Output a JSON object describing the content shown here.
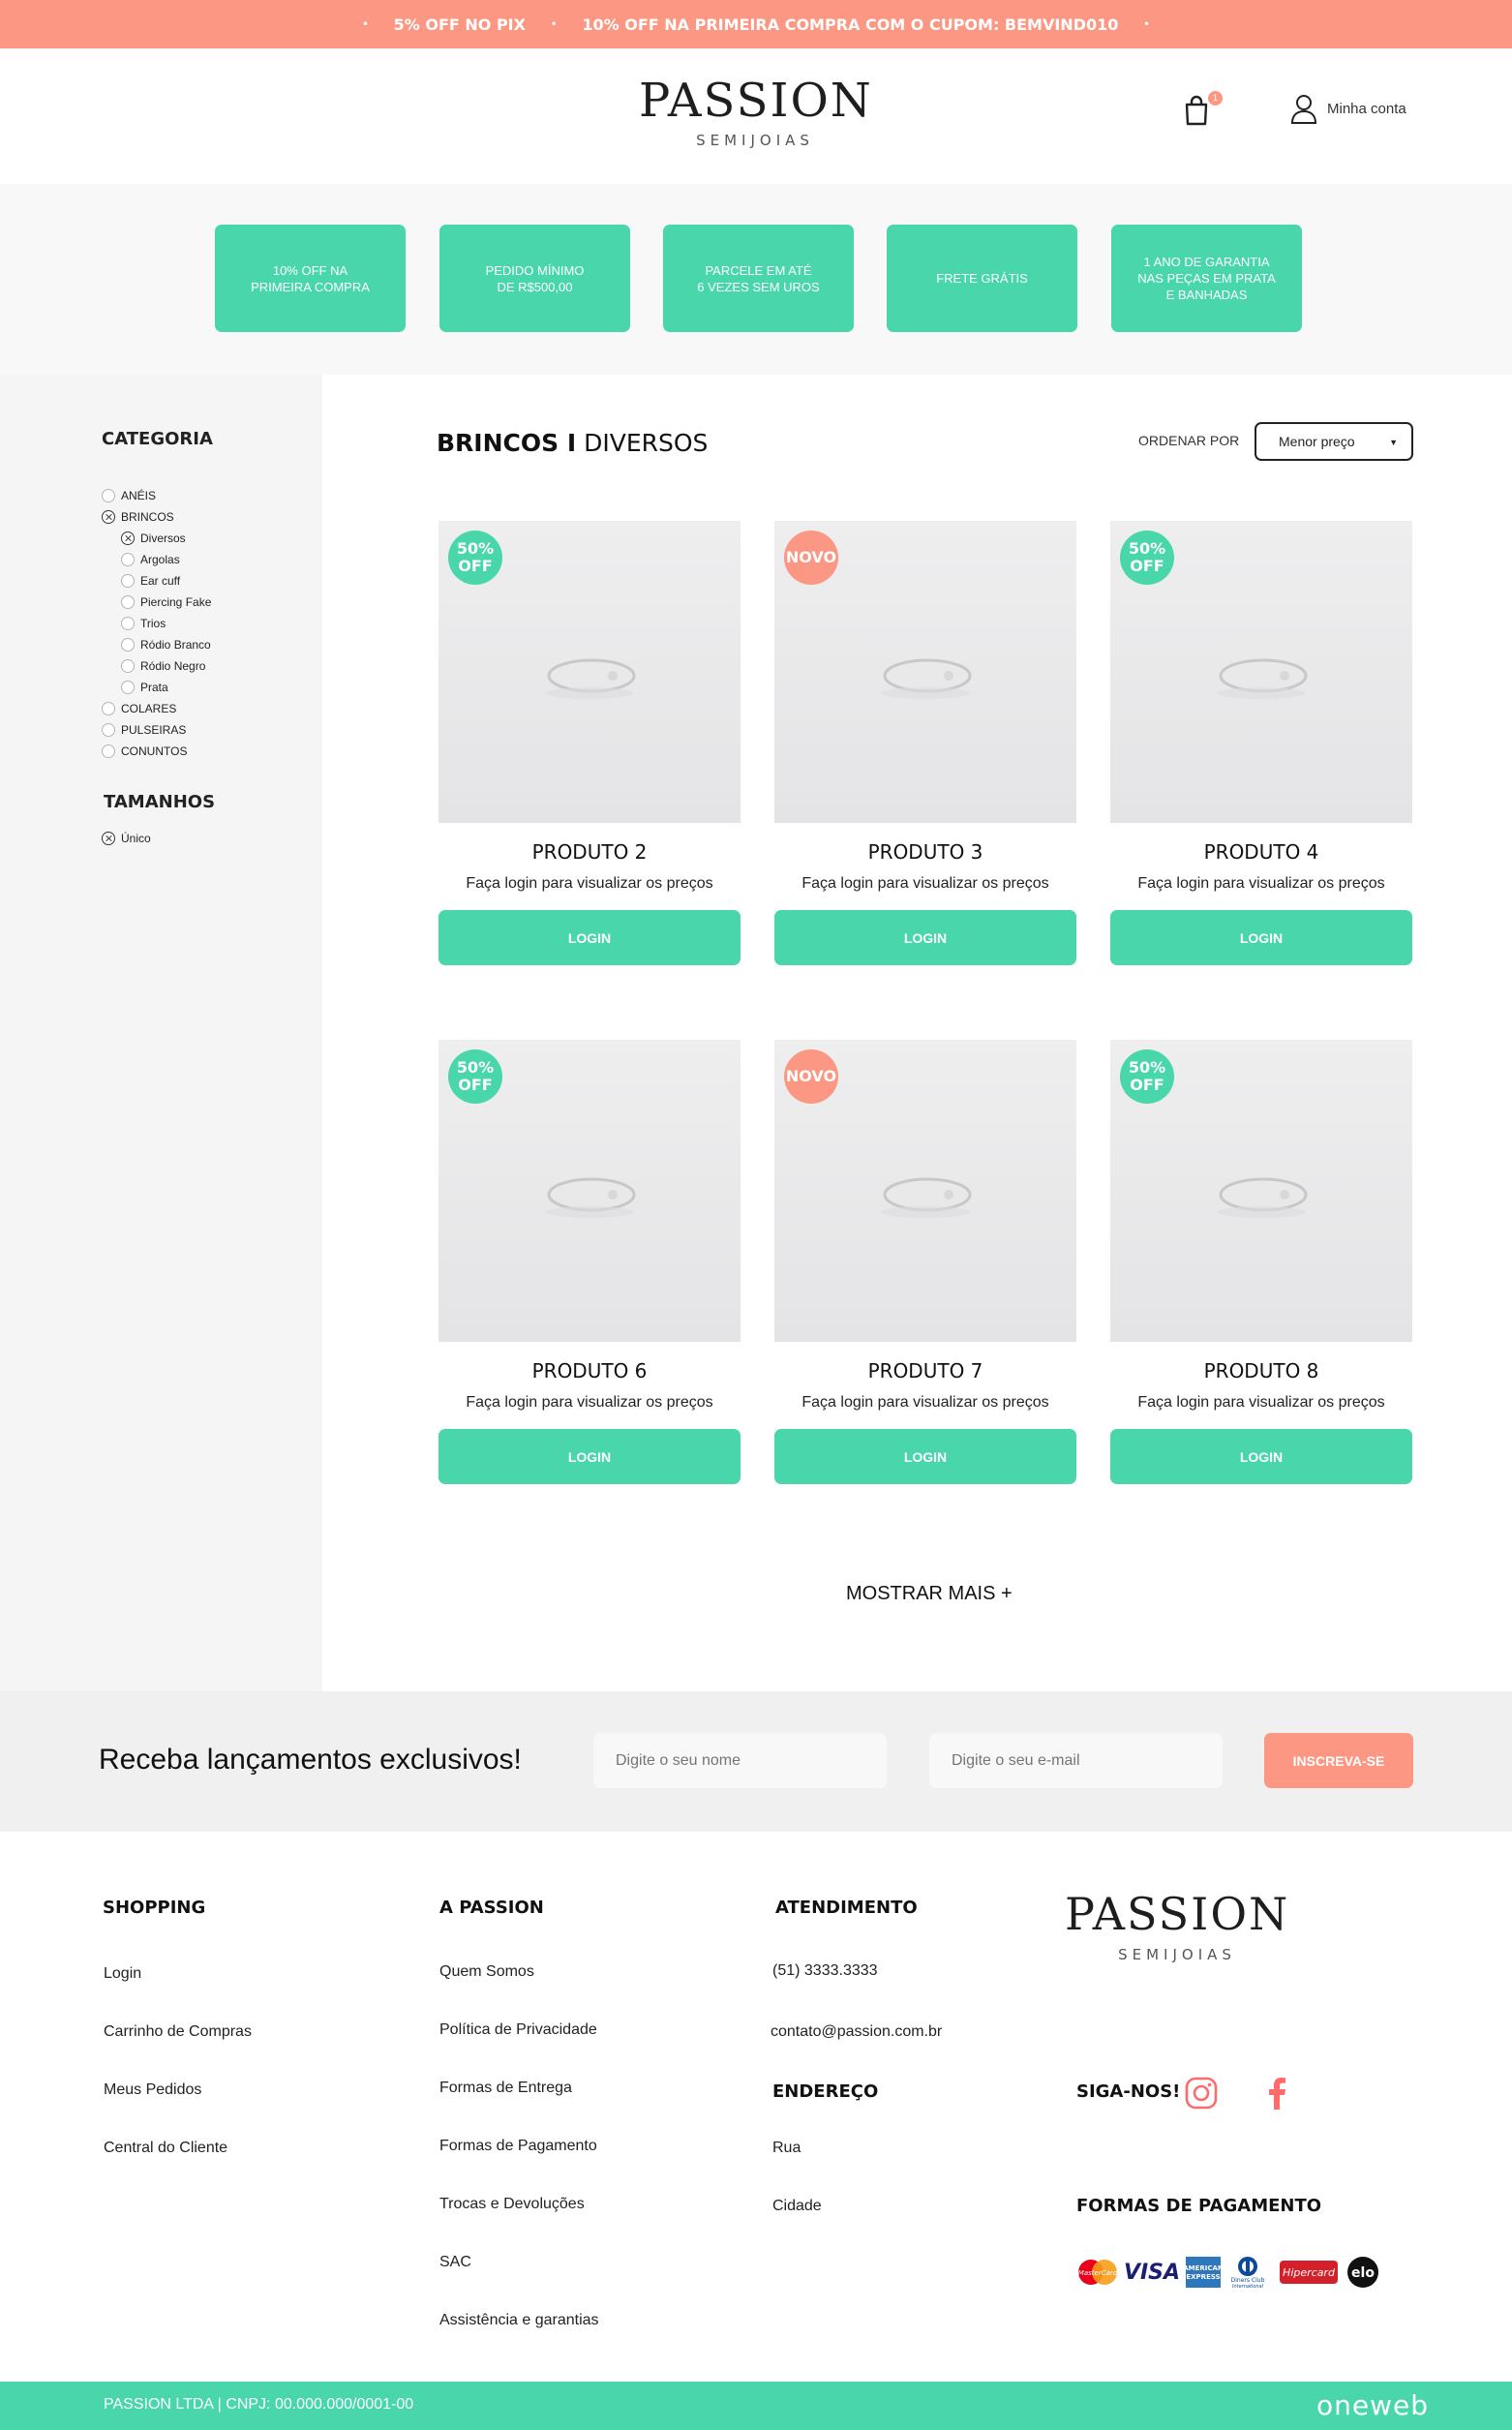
{
  "topbar": {
    "promo_1": "5% OFF NO PIX",
    "promo_2": "10% OFF NA PRIMEIRA COMPRA COM O CUPOM: BEMVIND010",
    "separator": "•"
  },
  "header": {
    "logo_main": "PASSION",
    "logo_sub": "SEMIJOIAS",
    "cart_count": "1",
    "account_label": "Minha conta"
  },
  "features": [
    {
      "text": "10% OFF NA\nPRIMEIRA COMPRA"
    },
    {
      "text": "PEDIDO MÍNIMO\nDE R$500,00"
    },
    {
      "text": "PARCELE EM ATÉ\n6 VEZES SEM UROS"
    },
    {
      "text": "FRETE GRÁTIS"
    },
    {
      "text": "1 ANO DE GARANTIA\nNAS PEÇAS EM PRATA\nE BANHADAS"
    }
  ],
  "sidebar": {
    "category_title": "CATEGORIA",
    "categories": [
      {
        "label": "ANÉIS",
        "selected": false
      },
      {
        "label": "BRINCOS",
        "selected": true
      },
      {
        "label": "Diversos",
        "selected": true,
        "sub": true
      },
      {
        "label": "Argolas",
        "selected": false,
        "sub": true
      },
      {
        "label": "Ear cuff",
        "selected": false,
        "sub": true
      },
      {
        "label": "Piercing Fake",
        "selected": false,
        "sub": true
      },
      {
        "label": "Trios",
        "selected": false,
        "sub": true
      },
      {
        "label": "Ródio Branco",
        "selected": false,
        "sub": true
      },
      {
        "label": "Ródio Negro",
        "selected": false,
        "sub": true
      },
      {
        "label": "Prata",
        "selected": false,
        "sub": true
      },
      {
        "label": "COLARES",
        "selected": false
      },
      {
        "label": "PULSEIRAS",
        "selected": false
      },
      {
        "label": "CONUNTOS",
        "selected": false
      }
    ],
    "sizes_title": "TAMANHOS",
    "sizes": [
      {
        "label": "Único",
        "selected": true
      }
    ]
  },
  "main": {
    "title_bold": "BRINCOS I",
    "title_rest": " DIVERSOS",
    "sort_label": "ORDENAR POR",
    "sort_value": "Menor preço",
    "price_text": "Faça login para visualizar os preços",
    "button_label": "LOGIN",
    "products": [
      {
        "name": "PRODUTO 2",
        "badge": "50%\nOFF",
        "badge_color": "#48d6aa"
      },
      {
        "name": "PRODUTO 3",
        "badge": "NOVO",
        "badge_color": "#fc9783"
      },
      {
        "name": "PRODUTO 4",
        "badge": "50%\nOFF",
        "badge_color": "#48d6aa"
      },
      {
        "name": "PRODUTO 6",
        "badge": "50%\nOFF",
        "badge_color": "#48d6aa"
      },
      {
        "name": "PRODUTO 7",
        "badge": "NOVO",
        "badge_color": "#fc9783"
      },
      {
        "name": "PRODUTO 8",
        "badge": "50%\nOFF",
        "badge_color": "#48d6aa"
      }
    ],
    "show_more": "MOSTRAR MAIS +"
  },
  "newsletter": {
    "title": "Receba lançamentos exclusivos!",
    "name_placeholder": "Digite o seu nome",
    "email_placeholder": "Digite o seu e-mail",
    "button": "INSCREVA-SE"
  },
  "footer": {
    "shopping_title": "SHOPPING",
    "shopping_links": [
      "Login",
      "Carrinho de Compras",
      "Meus Pedidos",
      "Central do Cliente"
    ],
    "passion_title": "A PASSION",
    "passion_links": [
      "Quem Somos",
      "Política de Privacidade",
      "Formas de Entrega",
      "Formas de Pagamento",
      "Trocas e Devoluções",
      "SAC",
      "Assistência e garantias"
    ],
    "service_title": "ATENDIMENTO",
    "phone": "(51) 3333.3333",
    "email": "contato@passion.com.br",
    "address_title": "ENDEREÇO",
    "address_lines": [
      "Rua",
      "Cidade"
    ],
    "logo_main": "PASSION",
    "logo_sub": "SEMIJOIAS",
    "follow_title": "SIGA-NOS!",
    "payment_title": "FORMAS DE PAGAMENTO",
    "payment_methods": [
      "MasterCard",
      "VISA",
      "AMERICAN EXPRESS",
      "Diners Club International",
      "Hipercard",
      "elo"
    ]
  },
  "bottombar": {
    "cnpj": "PASSION LTDA | CNPJ: 00.000.000/0001-00",
    "brand": "oneweb"
  },
  "colors": {
    "accent_green": "#48d6aa",
    "accent_salmon": "#fc9783"
  }
}
